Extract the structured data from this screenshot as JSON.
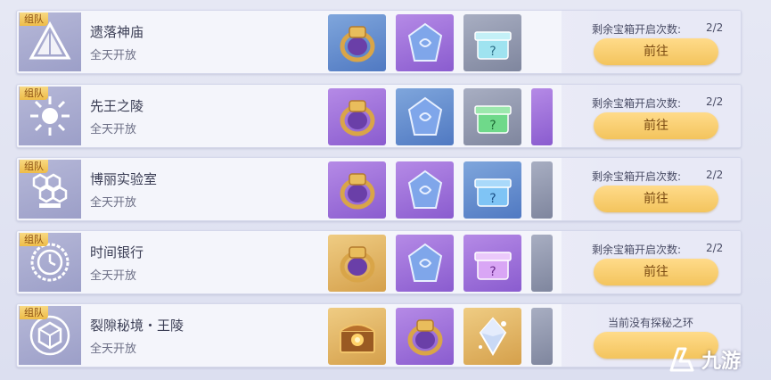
{
  "dungeons": [
    {
      "tag": "组队",
      "name": "遗落神庙",
      "schedule": "全天开放",
      "emblem_icon": "pyramid-icon",
      "rewards": [
        {
          "icon": "ring-icon",
          "bg": "blue"
        },
        {
          "icon": "crystal-icon",
          "bg": "purple"
        },
        {
          "icon": "mystery-box-icon",
          "bg": "grey",
          "box_color": "#9fe3f0"
        }
      ],
      "status": {
        "count_label": "剩余宝箱开启次数:",
        "count_value": "2/2",
        "button_label": "前往"
      }
    },
    {
      "tag": "组队",
      "name": "先王之陵",
      "schedule": "全天开放",
      "emblem_icon": "sun-icon",
      "rewards": [
        {
          "icon": "ring-icon",
          "bg": "purple"
        },
        {
          "icon": "crystal-icon",
          "bg": "blue"
        },
        {
          "icon": "mystery-box-icon",
          "bg": "grey",
          "box_color": "#6fd98a"
        }
      ],
      "status": {
        "count_label": "剩余宝箱开启次数:",
        "count_value": "2/2",
        "button_label": "前往"
      }
    },
    {
      "tag": "组队",
      "name": "博丽实验室",
      "schedule": "全天开放",
      "emblem_icon": "honeycomb-icon",
      "rewards": [
        {
          "icon": "ring-icon",
          "bg": "purple"
        },
        {
          "icon": "crystal-icon",
          "bg": "purple"
        },
        {
          "icon": "mystery-box-icon",
          "bg": "blue",
          "box_color": "#7fc4f5"
        }
      ],
      "status": {
        "count_label": "剩余宝箱开启次数:",
        "count_value": "2/2",
        "button_label": "前往"
      }
    },
    {
      "tag": "组队",
      "name": "时间银行",
      "schedule": "全天开放",
      "emblem_icon": "clock-icon",
      "rewards": [
        {
          "icon": "ring-icon",
          "bg": "gold"
        },
        {
          "icon": "crystal-icon",
          "bg": "purple"
        },
        {
          "icon": "mystery-box-icon",
          "bg": "purple",
          "box_color": "#d9a6f5"
        }
      ],
      "status": {
        "count_label": "剩余宝箱开启次数:",
        "count_value": "2/2",
        "button_label": "前往"
      }
    },
    {
      "tag": "组队",
      "name": "裂隙秘境・王陵",
      "schedule": "全天开放",
      "emblem_icon": "cube-icon",
      "rewards": [
        {
          "icon": "treasure-chest-icon",
          "bg": "gold"
        },
        {
          "icon": "ring-icon",
          "bg": "purple"
        },
        {
          "icon": "crystal-cluster-icon",
          "bg": "gold"
        }
      ],
      "status": {
        "notice": "当前没有探秘之环",
        "button_label": ""
      }
    }
  ],
  "watermark": {
    "text": "九游",
    "icon": "jiuyou-logo-icon"
  },
  "colors": {
    "tag_gold": "#eebc48",
    "button_gold": "#f3c45d",
    "emblem_lilac": "#9c9fc8"
  }
}
